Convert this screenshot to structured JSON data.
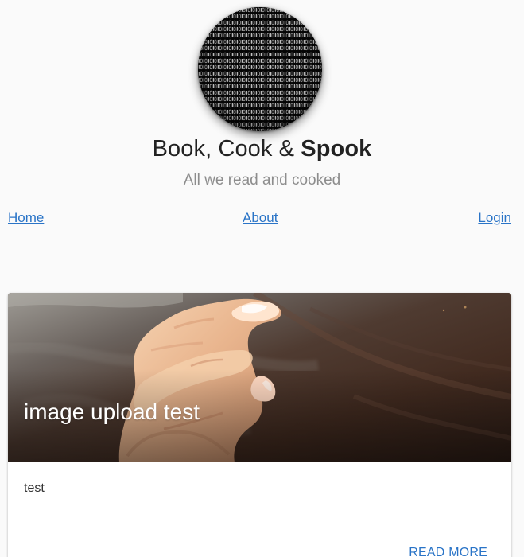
{
  "header": {
    "title_regular": "Book, Cook & ",
    "title_bold": "Spook",
    "tagline": "All we read and cooked"
  },
  "nav": {
    "home": "Home",
    "about": "About",
    "login": "Login"
  },
  "post": {
    "title": "image upload test",
    "excerpt": "test",
    "read_more": "READ MORE"
  },
  "colors": {
    "background": "#fafafa",
    "link": "#2a74c7",
    "tagline": "#8d8d8d",
    "card_background": "#ffffff"
  }
}
